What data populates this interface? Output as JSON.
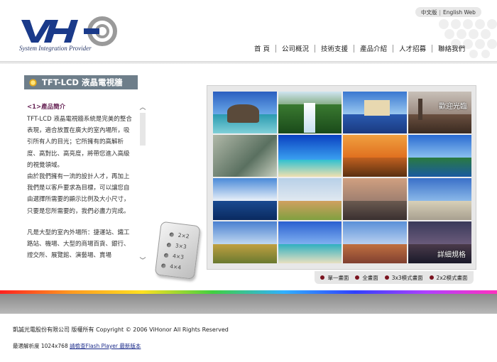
{
  "header": {
    "logo_tagline": "System Integration Provider",
    "lang": {
      "chinese": "中文版",
      "english": "English Web"
    },
    "nav": [
      "首 頁",
      "公司概況",
      "技術支援",
      "產品介紹",
      "人才招募",
      "聯絡我們"
    ]
  },
  "section": {
    "title": "TFT-LCD 液晶電視牆"
  },
  "intro": {
    "heading": "<1>產品簡介",
    "paragraphs": [
      "TFT-LCD 液晶電視牆系統是完美的整合表現，適合放置在廣大的室內場所，吸引所有人的目光；它所擁有的高解析度、高對比、高亮度，將帶您進入高級的視覺領域。",
      "由於我們擁有一流的設計人才，再加上我們是以客戶要求為目標，可以讓您自由選擇所需要的顯示比例及大小尺寸，只要是您所需要的，我們必盡力完成。",
      "凡是大型的室內外場所：捷運站、鐵工路站、機場、大型的商場百貨、銀行、證交所、展覽館、演藝場、賣場"
    ]
  },
  "remote": {
    "options": [
      "2×2",
      "3×3",
      "4×3",
      "4×4"
    ]
  },
  "wall": {
    "welcome_label": "歡迎光臨",
    "detail_label": "詳細規格"
  },
  "modes": [
    "單一畫面",
    "全畫面",
    "3x3模式畫面",
    "2x2模式畫面"
  ],
  "footer": {
    "copyright": "凱誠光電股份有限公司 版權所有 Copyright © 2006 ViHonor All Rights Reserved",
    "resolution_text": "最適解析度 1024x768",
    "flash_link": "請檢查Flash Player 最新版本"
  },
  "colors": {
    "title_tab_bg": "#6e7e8a",
    "heading_color": "#6b2a5a",
    "mode_dot": "#7a1420",
    "logo_blue": "#1a3a8a"
  }
}
